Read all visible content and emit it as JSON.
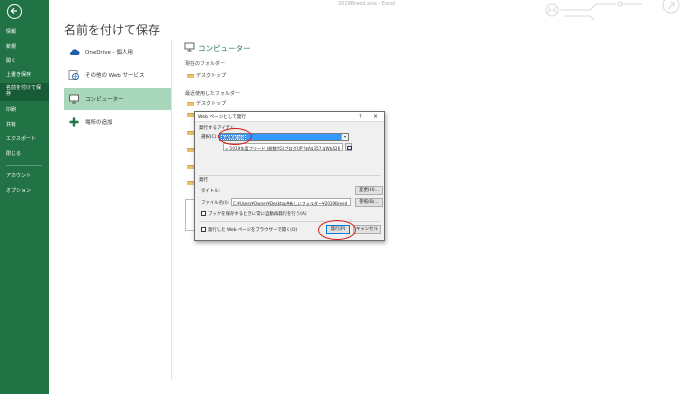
{
  "window": {
    "doc_title": "2019Breed.xlsx - Excel"
  },
  "sidebar": {
    "items": [
      {
        "label": "情報"
      },
      {
        "label": "新規"
      },
      {
        "label": "開く"
      },
      {
        "label": "上書き保存"
      },
      {
        "label": "名前を付けて保存",
        "active": true
      },
      {
        "label": "印刷"
      },
      {
        "label": "共有"
      },
      {
        "label": "エクスポート"
      },
      {
        "label": "閉じる"
      },
      {
        "label": "アカウント"
      },
      {
        "label": "オプション"
      }
    ],
    "bg_color": "#217346"
  },
  "main": {
    "heading": "名前を付けて保存",
    "places": [
      {
        "label": "OneDrive - 個人用",
        "icon": "cloud-icon"
      },
      {
        "label": "その他の Web サービス",
        "icon": "globe-icon"
      },
      {
        "label": "コンピューター",
        "icon": "computer-icon",
        "selected": true
      },
      {
        "label": "場所の追加",
        "icon": "plus-icon"
      }
    ],
    "panel": {
      "title": "コンピューター",
      "current_folder_label": "現在のフォルダー",
      "current_folder": "デスクトップ",
      "recent_label": "最近使用したフォルダー",
      "recent_folders": [
        "デスクトップ"
      ]
    }
  },
  "dialog": {
    "title": "Web ページとして発行",
    "help": "?",
    "close": "×",
    "items_group": "発行するアイテム",
    "select_label": "選択(C):",
    "select_value": "セルの範囲",
    "range_value": "='2019年度ブリード (総数YG)プログUP'!$A$357:$W$426",
    "publish_group": "発行",
    "title_label": "タイトル:",
    "change_button": "変更(H)...",
    "filename_label": "ファイル名(I):",
    "filename_value": "C:¥Users¥Owner¥Desktop¥新しいフォルダー¥2019Breed",
    "browse_button": "参照(B)...",
    "autorepublish_label": "ブックを保存するときに常に自動再発行を行う(A)",
    "open_in_browser_label": "発行した Web ページをブラウザーで開く(O)",
    "publish_button": "発行(P)",
    "cancel_button": "キャンセル",
    "autorepublish_checked": false,
    "open_in_browser_checked": false
  },
  "colors": {
    "accent": "#217346",
    "highlight": "#3399ff",
    "annotation": "#d91a1a"
  }
}
